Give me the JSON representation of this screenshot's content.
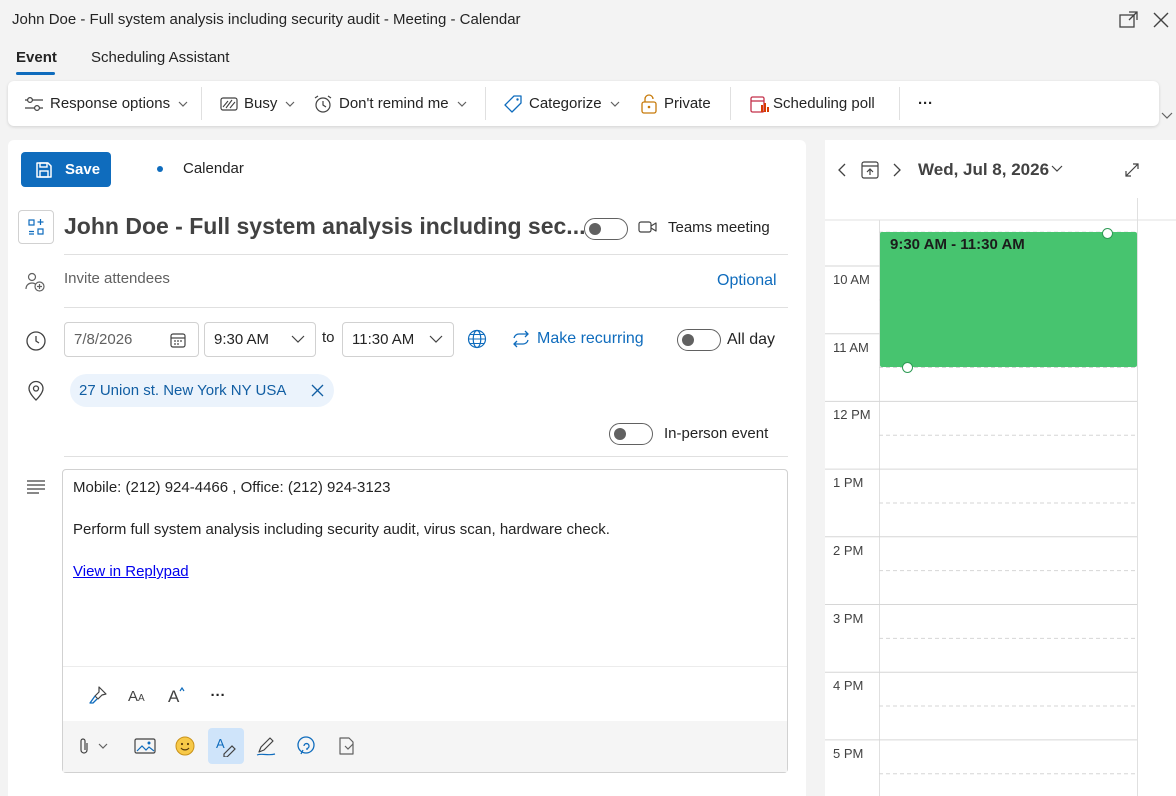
{
  "window": {
    "title": "John Doe - Full system analysis including security audit - Meeting - Calendar"
  },
  "tabs": [
    {
      "label": "Event",
      "active": true
    },
    {
      "label": "Scheduling Assistant",
      "active": false
    }
  ],
  "toolbar": {
    "response_options": "Response options",
    "busy": "Busy",
    "dont_remind": "Don't remind me",
    "categorize": "Categorize",
    "private": "Private",
    "scheduling_poll": "Scheduling poll",
    "more": "···"
  },
  "form": {
    "save_label": "Save",
    "calendar_label": "Calendar",
    "title": "John Doe - Full system analysis including sec...",
    "teams_meeting_label": "Teams meeting",
    "invite_placeholder": "Invite attendees",
    "optional_label": "Optional",
    "date": "7/8/2026",
    "start_time": "9:30 AM",
    "to_label": "to",
    "end_time": "11:30 AM",
    "make_recurring": "Make recurring",
    "all_day_label": "All day",
    "location": "27 Union st. New York NY USA",
    "in_person_label": "In-person event",
    "toggles": {
      "teams_meeting": false,
      "all_day": false,
      "in_person": false
    }
  },
  "body": {
    "line1": "Mobile: (212) 924-4466 , Office: (212) 924-3123",
    "line2": "Perform full system analysis including security audit, virus scan, hardware check.",
    "link": "View in Replypad",
    "format_more": "···"
  },
  "calendar_pane": {
    "date_label": "Wed, Jul 8, 2026",
    "hours": [
      "10 AM",
      "11 AM",
      "12 PM",
      "1 PM",
      "2 PM",
      "3 PM",
      "4 PM",
      "5 PM"
    ],
    "event_time": "9:30 AM - 11:30 AM",
    "event_color": "#47c46f"
  },
  "colors": {
    "accent": "#0f6cbd",
    "link": "#0f6cbd"
  }
}
